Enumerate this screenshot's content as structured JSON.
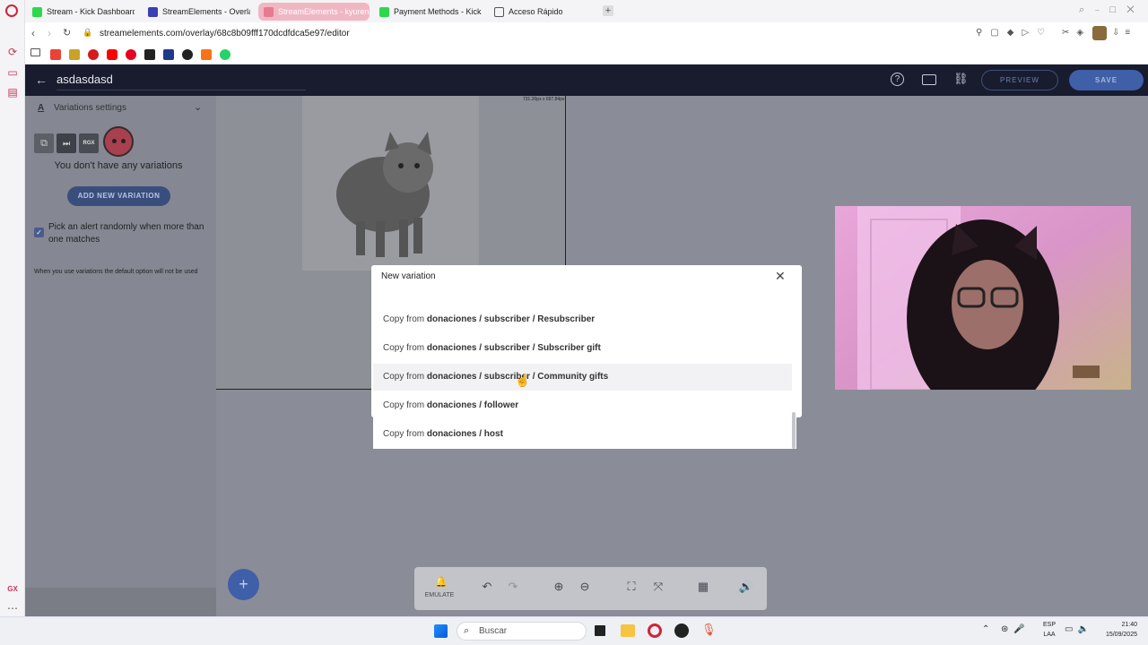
{
  "browser": {
    "tabs": [
      {
        "label": "Stream - Kick Dashboard",
        "active": false
      },
      {
        "label": "StreamElements - Overlay",
        "active": false
      },
      {
        "label": "StreamElements - kyuren",
        "active": true
      },
      {
        "label": "Payment Methods - Kick",
        "active": false
      },
      {
        "label": "Acceso Rápido",
        "active": false
      }
    ],
    "url": "streamelements.com/overlay/68c8b09fff170dcdfdca5e97/editor"
  },
  "editor": {
    "title": "asdasdasd",
    "preview_label": "PREVIEW",
    "save_label": "SAVE"
  },
  "sidebar": {
    "section_title": "Variations settings",
    "badge_text": "RGX",
    "empty_text": "You don't have any variations",
    "add_button": "ADD NEW VARIATION",
    "random_checkbox_label": "Pick an alert randomly when more than one matches",
    "random_checked": true,
    "note": "When you use variations the default option will not be used",
    "bottom_label": "GX"
  },
  "stage": {
    "dimensions_label": "731.20px x 697.84px"
  },
  "modal": {
    "title": "New variation",
    "copy_prefix": "Copy from",
    "options": [
      "donaciones / subscriber / Resubscriber",
      "donaciones / subscriber / Subscriber gift",
      "donaciones / subscriber / Community gifts",
      "donaciones / follower",
      "donaciones / host"
    ]
  },
  "toolbar": {
    "emulate_label": "EMULATE"
  },
  "taskbar": {
    "search_placeholder": "Buscar",
    "lang_line1": "ESP",
    "lang_line2": "LAA",
    "time": "21:40",
    "date": "15/09/2025"
  },
  "colors": {
    "header_bg": "#181c2e",
    "accent_button": "#3f5fa8",
    "active_tab": "#f0b7c2"
  }
}
